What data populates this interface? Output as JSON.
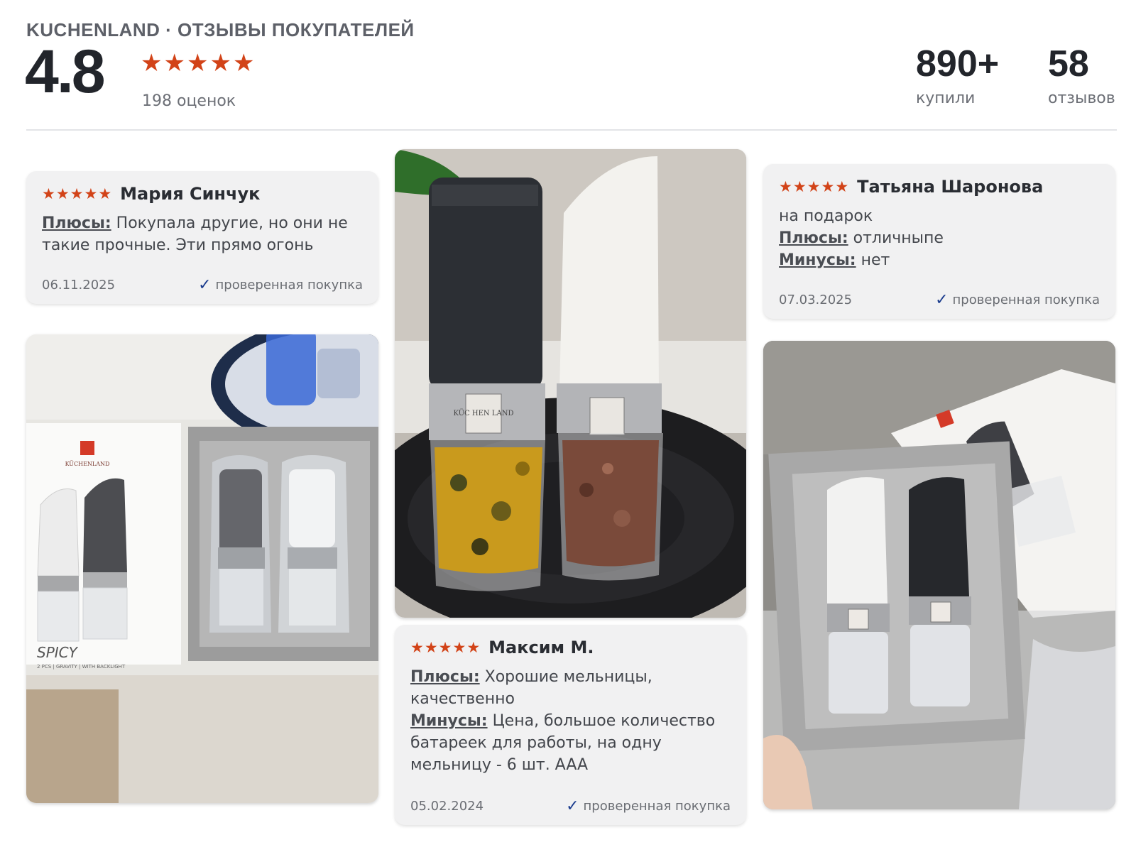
{
  "header": {
    "brand": "KUCHENLAND · ОТЗЫВЫ ПОКУПАТЕЛЕЙ",
    "rating": "4.8",
    "stars": 5,
    "ratings_count": "198 оценок",
    "bought_value": "890+",
    "bought_label": "купили",
    "reviews_value": "58",
    "reviews_label": "отзывов"
  },
  "colors": {
    "star": "#d24318",
    "check": "#1e3e8f",
    "card_bg": "#f1f1f2"
  },
  "reviews": [
    {
      "name": "Мария Синчук",
      "stars": 5,
      "plus_label": "Плюсы:",
      "plus_text": " Покупала другие, но они не такие прочные. Эти прямо огонь",
      "date": "06.11.2025",
      "verified": "проверенная покупка"
    },
    {
      "name": "Татьяна Шаронова",
      "stars": 5,
      "intro": "на подарок",
      "plus_label": "Плюсы:",
      "plus_text": " отличныпе",
      "minus_label": "Минусы:",
      "minus_text": " нет",
      "date": "07.03.2025",
      "verified": "проверенная покупка"
    },
    {
      "name": "Максим М.",
      "stars": 5,
      "plus_label": "Плюсы:",
      "plus_text": " Хорошие мельницы, качественно",
      "minus_label": "Минусы:",
      "minus_text": " Цена, большое количество батареек для работы, на одну мельницу - 6 шт. AAA",
      "date": "05.02.2024",
      "verified": "проверенная покупка"
    }
  ],
  "photos": {
    "box_brand": "KÜCHENLAND",
    "box_logo": "KÜC HEN LAND",
    "box_title": "SPICY",
    "box_sub": "2 PCS | GRAVITY | WITH BACKLIGHT",
    "band_label": "KÜC HEN LAND"
  }
}
